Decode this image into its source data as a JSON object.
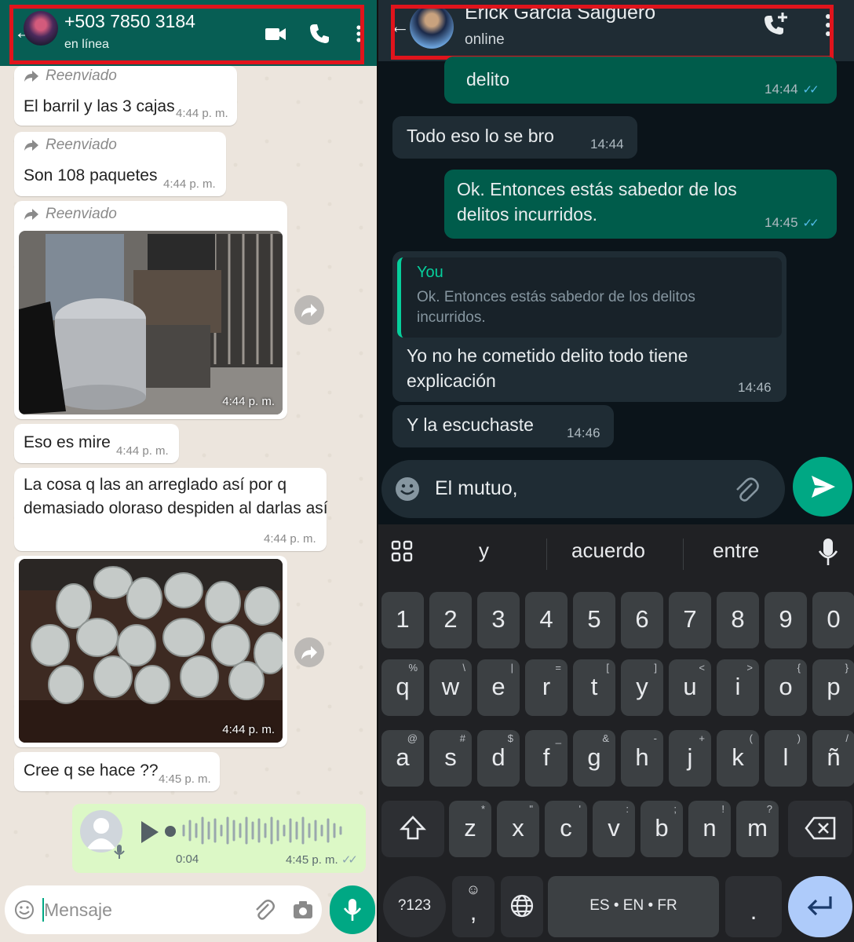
{
  "left_chat": {
    "contact": "+503 7850 3184",
    "status": "en línea",
    "forwarded_label": "Reenviado",
    "messages": [
      {
        "text": "El barril y las 3 cajas",
        "time": "4:44 p. m."
      },
      {
        "text": "Son 108 paquetes",
        "time": "4:44 p. m."
      },
      {
        "photo_time": "4:44 p. m."
      },
      {
        "text": "Eso es mire",
        "time": "4:44 p. m."
      },
      {
        "line1": "La cosa q las an arreglado así por q",
        "line2": "demasiado oloraso despiden al darlas así",
        "time": "4:44 p. m."
      },
      {
        "photo_time": "4:44 p. m."
      },
      {
        "text": "Cree q se hace ??",
        "time": "4:45 p. m."
      }
    ],
    "voice": {
      "duration": "0:04",
      "time": "4:45 p. m."
    },
    "input_placeholder": "Mensaje",
    "colors": {
      "header": "#075e54",
      "accent": "#00a884",
      "outgoing": "#dcf8c6",
      "highlight_box": "#e0141c"
    }
  },
  "right_chat": {
    "contact": "Erick Garcia Salguero",
    "status": "online",
    "messages": [
      {
        "dir": "out",
        "text": "delito",
        "time": "14:44"
      },
      {
        "dir": "in",
        "text": "Todo eso lo se bro",
        "time": "14:44"
      },
      {
        "dir": "out",
        "line1": "Ok. Entonces estás sabedor de los",
        "line2": "delitos incurridos.",
        "time": "14:45"
      },
      {
        "dir": "in",
        "quote_author": "You",
        "quote_line1": "Ok. Entonces estás sabedor de los delitos",
        "quote_line2": "incurridos.",
        "line1": "Yo no he cometido delito todo tiene",
        "line2": "explicación",
        "time": "14:46"
      },
      {
        "dir": "in",
        "text": "Y la escuchaste",
        "time": "14:46"
      }
    ],
    "input_value": "El mutuo,",
    "keyboard": {
      "suggestions": [
        "y",
        "acuerdo",
        "entre"
      ],
      "numbers": [
        "1",
        "2",
        "3",
        "4",
        "5",
        "6",
        "7",
        "8",
        "9",
        "0"
      ],
      "row1": [
        "q",
        "w",
        "e",
        "r",
        "t",
        "y",
        "u",
        "i",
        "o",
        "p"
      ],
      "row1_alt": [
        "%",
        "\\",
        "|",
        "=",
        "[",
        "]",
        "<",
        ">",
        "{",
        "}"
      ],
      "row2": [
        "a",
        "s",
        "d",
        "f",
        "g",
        "h",
        "j",
        "k",
        "l",
        "ñ"
      ],
      "row2_alt": [
        "@",
        "#",
        "$",
        "_",
        "&",
        "-",
        "+",
        "(",
        ")",
        "/"
      ],
      "row3": [
        "z",
        "x",
        "c",
        "v",
        "b",
        "n",
        "m"
      ],
      "row3_alt": [
        "*",
        "\"",
        "'",
        ":",
        ";",
        "!",
        "?"
      ],
      "symbols_key": "?123",
      "comma": ",",
      "space_label": "ES • EN • FR",
      "period": "."
    },
    "colors": {
      "background": "#0b141a",
      "outgoing": "#005c4b",
      "incoming": "#1f2c34",
      "quote_author": "#06cf9c",
      "ticks": "#53bdeb"
    }
  }
}
